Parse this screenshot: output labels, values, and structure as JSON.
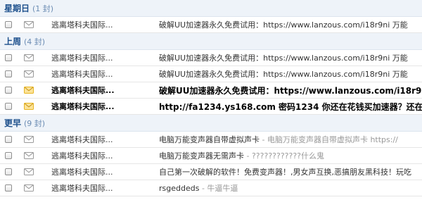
{
  "groups": [
    {
      "title": "星期日",
      "count": "(1 封)",
      "rows": [
        {
          "sender": "逃离塔科夫国际...",
          "subject": "破解UU加速器永久免费试用：https://www.lanzous.com/i18r9ni 万能",
          "snippet": "",
          "unread": false
        }
      ]
    },
    {
      "title": "上周",
      "count": "(4 封)",
      "rows": [
        {
          "sender": "逃离塔科夫国际...",
          "subject": "破解UU加速器永久免费试用：https://www.lanzous.com/i18r9ni 万能",
          "snippet": "",
          "unread": false
        },
        {
          "sender": "逃离塔科夫国际...",
          "subject": "破解UU加速器永久免费试用：https://www.lanzous.com/i18r9ni 万能",
          "snippet": "",
          "unread": false
        },
        {
          "sender": "逃离塔科夫国际...",
          "subject": "破解UU加速器永久免费试用：https://www.lanzous.com/i18r9n",
          "snippet": "",
          "unread": true
        },
        {
          "sender": "逃离塔科夫国际...",
          "subject": "http://fa1234.ys168.com  密码1234 你还在花钱买加速器？还在",
          "snippet": "",
          "unread": true
        }
      ]
    },
    {
      "title": "更早",
      "count": "(9 封)",
      "rows": [
        {
          "sender": "逃离塔科夫国际...",
          "subject": "电脑万能变声器自带虚拟声卡",
          "snippet": " - 电脑万能变声器自带虚拟声卡    https://",
          "unread": false
        },
        {
          "sender": "逃离塔科夫国际...",
          "subject": "电脑万能变声器无需声卡",
          "snippet": "   - ????????????什么鬼",
          "unread": false
        },
        {
          "sender": "逃离塔科夫国际...",
          "subject": "自己第一次破解的软件！免费变声器！,男女声互换,恶搞朋友黑科技！玩吃",
          "snippet": "",
          "unread": false
        },
        {
          "sender": "逃离塔科夫国际...",
          "subject": "rsgeddeds",
          "snippet": " - 牛逼牛逼",
          "unread": false
        }
      ]
    }
  ],
  "colors": {
    "group_title": "#1c4f8c",
    "envelope_read": "#9a9a9a",
    "envelope_unread": "#e8b520"
  }
}
